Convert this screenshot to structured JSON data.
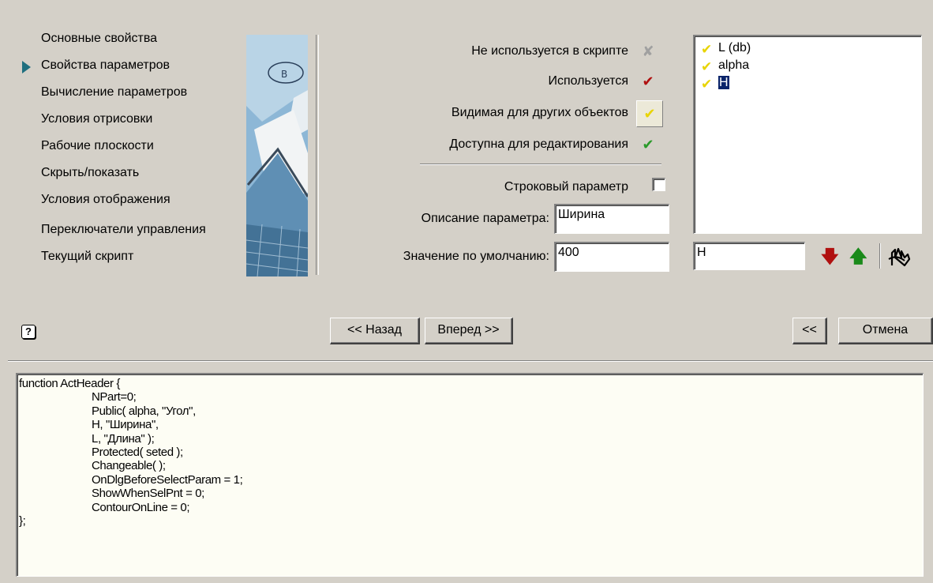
{
  "nav": {
    "items": [
      "Основные свойства",
      "Свойства параметров",
      "Вычисление параметров",
      "Условия отрисовки",
      "Рабочие плоскости",
      "Скрыть/показать",
      "Условия отображения",
      "Переключатели управления",
      "Текущий скрипт"
    ],
    "active_index": 1
  },
  "properties": {
    "not_used": "Не используется в скрипте",
    "used": "Используется",
    "visible": "Видимая для других объектов",
    "editable": "Доступна для редактирования",
    "string_param": "Строковый параметр",
    "description_label": "Описание параметра:",
    "description_value": "Ширина",
    "default_label": "Значение по умолчанию:",
    "default_value": "400"
  },
  "param_list": {
    "items": [
      "L  (db)",
      "alpha",
      "H"
    ],
    "selected_index": 2,
    "name_input": "H"
  },
  "buttons": {
    "back": "<< Назад",
    "next": "Вперед >>",
    "collapse": "<<",
    "cancel": "Отмена"
  },
  "script": {
    "lines": [
      "function ActHeader {",
      "NPart=0;",
      "Public( alpha, \"Угол\",",
      "H, \"Ширина\",",
      "L, \"Длина\" );",
      "Protected( seted );",
      "Changeable( );",
      "OnDlgBeforeSelectParam = 1;",
      "ShowWhenSelPnt = 0;",
      "ContourOnLine = 0;",
      "};"
    ]
  },
  "colors": {
    "window_bg": "#d4d0c8",
    "nav_arrow": "#1f6f7f",
    "check_used": "#b01010",
    "check_visible": "#e8d400",
    "check_editable": "#2a9a2a",
    "arrow_down": "#b01010",
    "arrow_up": "#1a8a1a",
    "selection": "#0a246a"
  }
}
